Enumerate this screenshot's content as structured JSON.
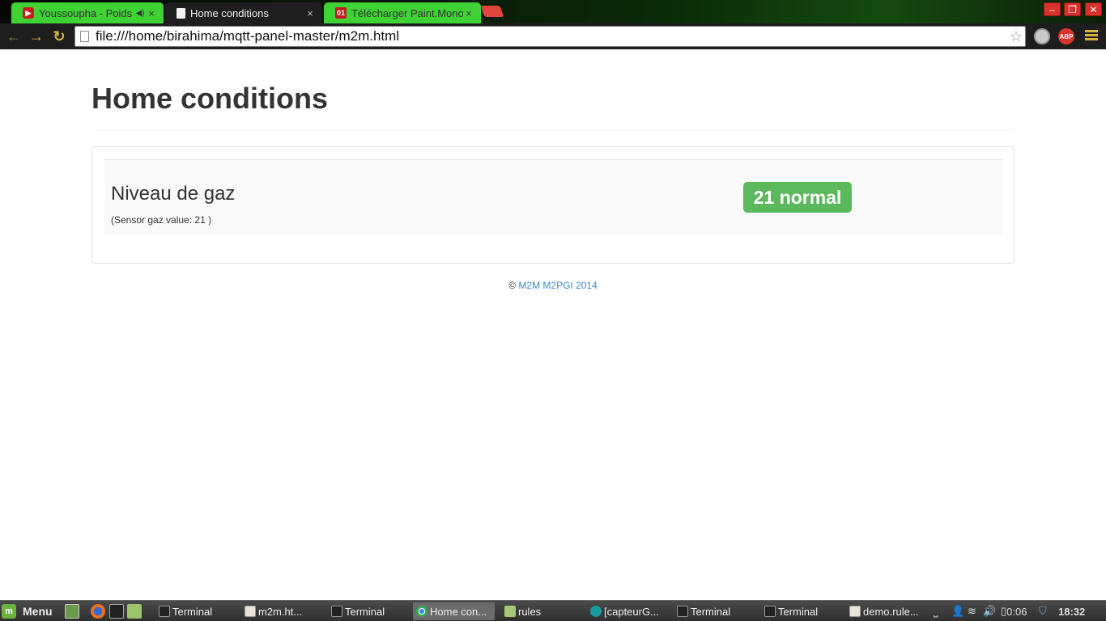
{
  "browser": {
    "tabs": [
      {
        "title": "Youssoupha - Poids P",
        "close": "×"
      },
      {
        "title": "Home conditions",
        "close": "×"
      },
      {
        "title": "Télécharger Paint.Mono",
        "close": "×"
      }
    ],
    "url": "file:///home/birahima/mqtt-panel-master/m2m.html",
    "extensions": {
      "abp": "ABP"
    },
    "window_buttons": {
      "minimize": "–",
      "maximize": "❐",
      "close": "✕"
    }
  },
  "page": {
    "title": "Home conditions",
    "sensor": {
      "name": "Niveau de gaz",
      "detail": "(Sensor gaz value: 21 )",
      "status": "21 normal",
      "status_color": "#5cb85c"
    },
    "footer": {
      "copyright": "©",
      "link": "M2M M2PGI 2014"
    }
  },
  "taskbar": {
    "menu_label": "Menu",
    "tasks": [
      {
        "label": "Terminal",
        "icon": "terminal-icon"
      },
      {
        "label": "m2m.ht...",
        "icon": "text-editor-icon"
      },
      {
        "label": "Terminal",
        "icon": "terminal-icon"
      },
      {
        "label": "Home con...",
        "icon": "chrome-icon"
      },
      {
        "label": "rules",
        "icon": "folder-icon"
      },
      {
        "label": "[capteurG...",
        "icon": "arduino-icon"
      },
      {
        "label": "Terminal",
        "icon": "terminal-icon"
      },
      {
        "label": "Terminal",
        "icon": "terminal-icon"
      },
      {
        "label": "demo.rule...",
        "icon": "text-editor-icon"
      }
    ],
    "battery_time": "0:06",
    "clock": "18:32"
  }
}
